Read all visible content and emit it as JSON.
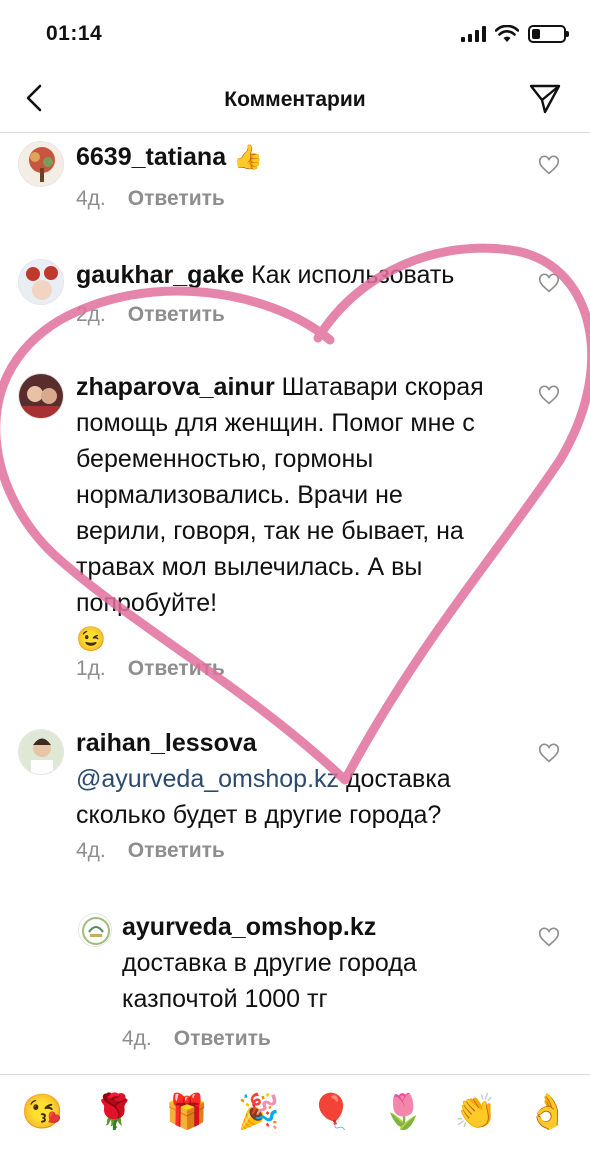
{
  "status_bar": {
    "time": "01:14"
  },
  "nav": {
    "title": "Комментарии",
    "back_icon": "chevron-left-icon",
    "send_icon": "paper-plane-icon"
  },
  "comments": [
    {
      "username": "6639_tatiana",
      "text": "",
      "emoji": "👍",
      "time": "4д.",
      "reply": "Ответить"
    },
    {
      "username": "gaukhar_gake",
      "text": "Как использовать",
      "time": "2д.",
      "reply": "Ответить"
    },
    {
      "username": "zhaparova_ainur",
      "text": "Шатавари скорая помощь для женщин. Помог мне с беременностью, гормоны нормализовались. Врачи не верили, говоря, так не бывает, на травах мол вылечилась. А вы попробуйте!",
      "emoji": "😉",
      "time": "1д.",
      "reply": "Ответить"
    },
    {
      "username": "raihan_lessova",
      "mention": "@ayurveda_omshop.kz",
      "text": "доставка сколько будет в другие города?",
      "time": "4д.",
      "reply": "Ответить"
    },
    {
      "username": "ayurveda_omshop.kz",
      "text": "доставка в другие города казпочтой 1000 тг",
      "time": "4д.",
      "reply": "Ответить"
    }
  ],
  "emoji_bar": [
    "😘",
    "🌹",
    "🎁",
    "🎉",
    "🎈",
    "🌷",
    "👏",
    "👌"
  ],
  "colors": {
    "heart": "#e0709c",
    "muted": "#8e8e8e",
    "mention": "#2b4a6f"
  }
}
